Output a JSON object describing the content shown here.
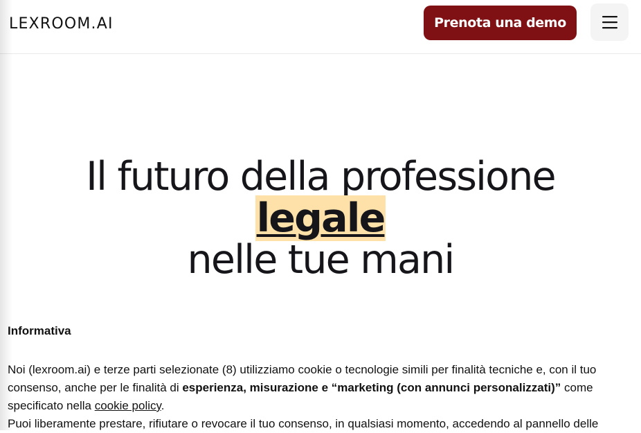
{
  "header": {
    "logo_text": "LEXROOM.AI",
    "demo_button_label": "Prenota una demo",
    "menu_icon": "hamburger-menu-icon",
    "brand_color": "#7f1014"
  },
  "hero": {
    "line1": "Il futuro della professione",
    "line2_highlight": "legale",
    "line3": "nelle tue mani",
    "highlight_color": "#fde1a8"
  },
  "cookie_notice": {
    "title": "Informativa",
    "p1_text_before": "Noi (lexroom.ai) e terze parti selezionate (8) utilizziamo cookie o tecnologie simili per finalità tecniche e, con il tuo consenso, anche per le finalità di ",
    "p1_bold": "esperienza, misurazione e “marketing (con annunci personalizzati)”",
    "p1_text_after": " come specificato nella ",
    "cookie_policy_link": "cookie policy",
    "p1_end": ".",
    "p2_text": "Puoi liberamente prestare, rifiutare o revocare il tuo consenso, in qualsiasi momento, accedendo al pannello delle"
  }
}
